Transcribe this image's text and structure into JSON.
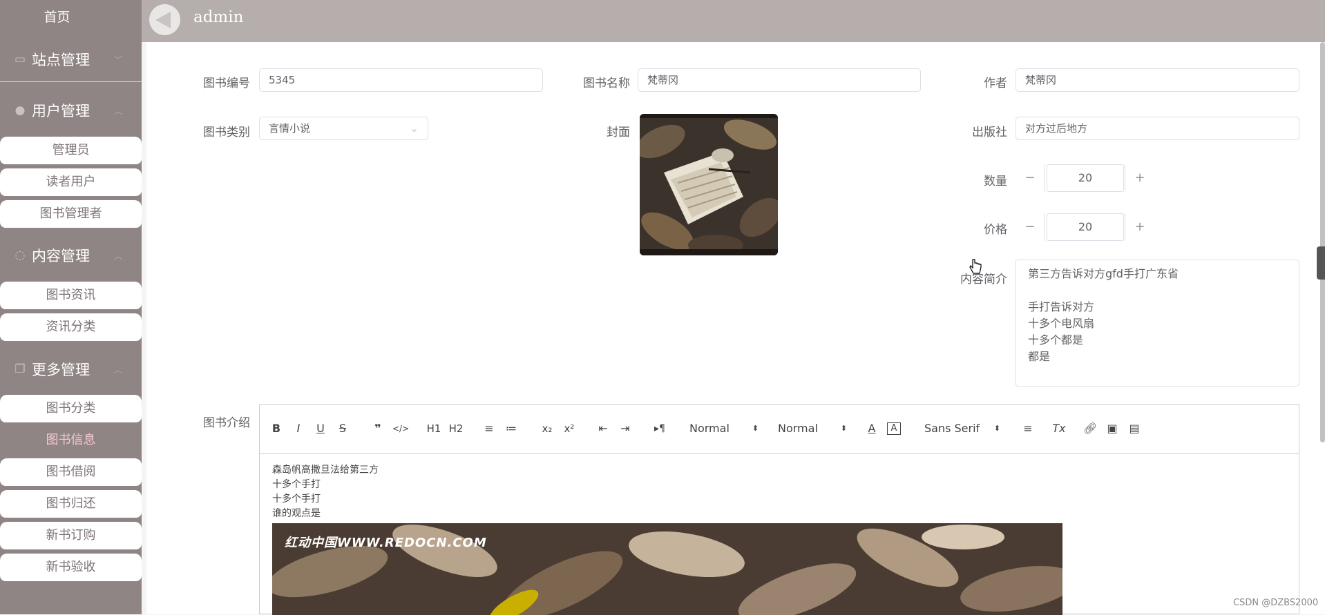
{
  "sidebar": {
    "home": "首页",
    "groups": [
      {
        "label": "站点管理"
      },
      {
        "label": "用户管理"
      },
      {
        "label": "内容管理"
      },
      {
        "label": "更多管理"
      }
    ],
    "items": [
      {
        "label": "管理员"
      },
      {
        "label": "读者用户"
      },
      {
        "label": "图书管理者"
      },
      {
        "label": "图书资讯"
      },
      {
        "label": "资讯分类"
      },
      {
        "label": "图书分类"
      },
      {
        "label": "图书信息",
        "active": true
      },
      {
        "label": "图书借阅"
      },
      {
        "label": "图书归还"
      },
      {
        "label": "新书订购"
      },
      {
        "label": "新书验收"
      }
    ]
  },
  "header": {
    "brand": "admin"
  },
  "form": {
    "book_no": {
      "label": "图书编号",
      "value": "5345"
    },
    "book_name": {
      "label": "图书名称",
      "value": "梵蒂冈"
    },
    "author": {
      "label": "作者",
      "value": "梵蒂冈"
    },
    "category": {
      "label": "图书类别",
      "value": "言情小说"
    },
    "cover": {
      "label": "封面"
    },
    "publisher": {
      "label": "出版社",
      "value": "对方过后地方"
    },
    "quantity": {
      "label": "数量",
      "value": "20"
    },
    "price": {
      "label": "价格",
      "value": "20"
    },
    "summary": {
      "label": "内容简介",
      "value": "第三方告诉对方gfd手打广东省\n\n手打告诉对方\n十多个电风扇\n十多个都是\n都是"
    },
    "intro": {
      "label": "图书介绍"
    }
  },
  "editor": {
    "toolbar": {
      "bold": "B",
      "italic": "I",
      "underline": "U",
      "strike": "S",
      "blockquote": "❞",
      "code": "</>",
      "h1": "H1",
      "h2": "H2",
      "ordered_list": "≡",
      "bullet_list": "≔",
      "sub": "x₂",
      "sup": "x²",
      "outdent": "⇤",
      "indent": "⇥",
      "direction": "▸¶",
      "size": "Normal",
      "header": "Normal",
      "font": "Sans Serif",
      "align": "≡",
      "clean": "Tx"
    },
    "lines": [
      "森岛帆高撒旦法给第三方",
      "十多个手打",
      "十多个手打",
      "谁的观点是"
    ],
    "image_watermark": "红动中国WWW.REDOCN.COM"
  },
  "credit": "CSDN @DZBS2000"
}
